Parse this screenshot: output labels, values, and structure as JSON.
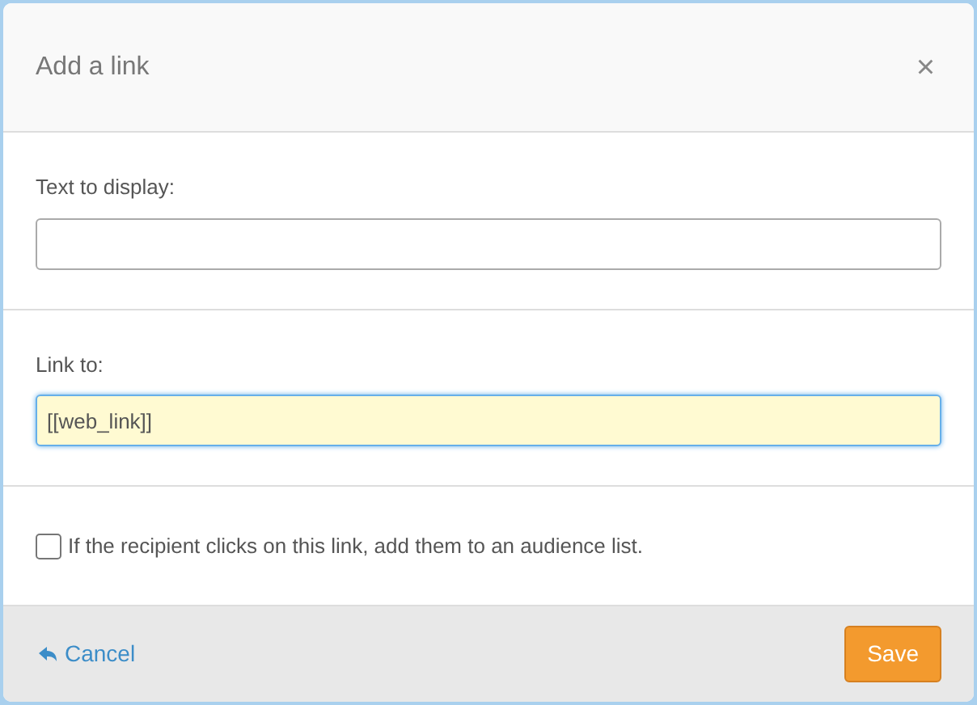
{
  "dialog": {
    "title": "Add a link",
    "close": "×"
  },
  "fields": [
    {
      "label": "Text to display:",
      "focused": false
    },
    {
      "label": "Link to:",
      "value": "[[web_link]]",
      "focused": true
    }
  ],
  "checkbox": {
    "label": "If the recipient clicks on this link, add them to an audience list.",
    "checked": false
  },
  "footer": {
    "cancel": "Cancel",
    "save": "Save"
  }
}
